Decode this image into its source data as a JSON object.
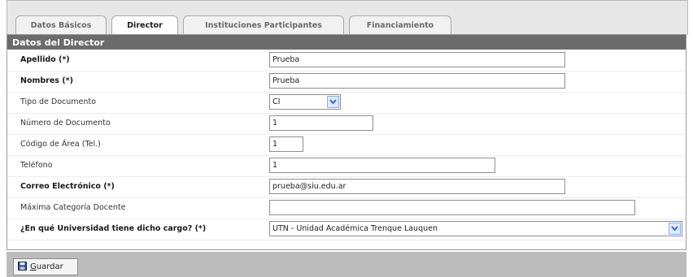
{
  "tabs": [
    {
      "label": "Datos Básicos"
    },
    {
      "label": "Director"
    },
    {
      "label": "Instituciones Participantes"
    },
    {
      "label": "Financiamiento"
    }
  ],
  "panel": {
    "title": "Datos del Director"
  },
  "fields": {
    "apellido": {
      "label": "Apellido (*)",
      "value": "Prueba"
    },
    "nombres": {
      "label": "Nombres (*)",
      "value": "Prueba"
    },
    "tipo_documento": {
      "label": "Tipo de Documento",
      "value": "CI"
    },
    "numero_documento": {
      "label": "Número de Documento",
      "value": "1"
    },
    "codigo_area": {
      "label": "Código de Área (Tel.)",
      "value": "1"
    },
    "telefono": {
      "label": "Teléfono",
      "value": "1"
    },
    "correo": {
      "label": "Correo Electrónico (*)",
      "value": "prueba@siu.edu.ar"
    },
    "categoria_docente": {
      "label": "Máxima Categoría Docente",
      "value": ""
    },
    "universidad": {
      "label": "¿En qué Universidad tiene dicho cargo? (*)",
      "value": "UTN - Unidad Académica Trenque Lauquen"
    }
  },
  "footer": {
    "save_label": "Guardar",
    "save_mnemonic": "G",
    "save_rest": "uardar"
  },
  "icons": {
    "save": "floppy-disk-icon",
    "dropdown": "chevron-down-icon"
  },
  "colors": {
    "header_bg": "#6b6b6b",
    "footer_bg": "#bcbcbc",
    "dropdown_arrow": "#3a63c8"
  }
}
